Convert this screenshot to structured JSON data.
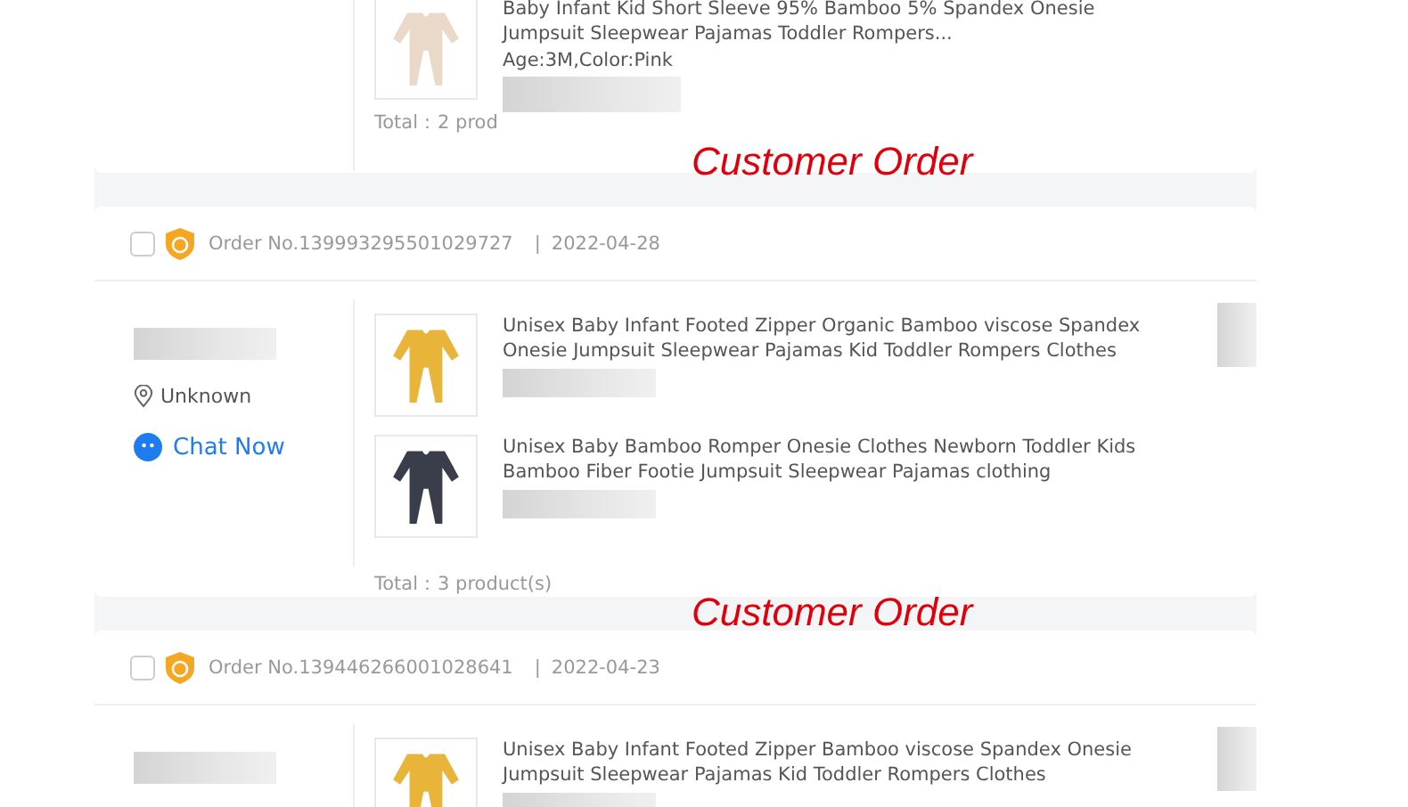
{
  "orders": [
    {
      "products": [
        {
          "title": "Baby Infant Kid Short Sleeve 95% Bamboo 5% Spandex Onesie Jumpsuit Sleepwear Pajamas Toddler Rompers...",
          "variant": "Age:3M,Color:Pink",
          "color": "#ead8c8"
        }
      ],
      "total": "Total：2 prod"
    },
    {
      "order_no": "Order No.139993295501029727",
      "separator": "|",
      "date": "2022-04-28",
      "checked": false,
      "location": "Unknown",
      "chat_label": "Chat Now",
      "products": [
        {
          "title": "Unisex Baby Infant Footed Zipper Organic Bamboo viscose Spandex Onesie Jumpsuit Sleepwear Pajamas Kid Toddler Rompers Clothes",
          "color": "#e8b53a"
        },
        {
          "title": "Unisex Baby Bamboo Romper Onesie Clothes Newborn Toddler Kids Bamboo Fiber Footie Jumpsuit Sleepwear Pajamas clothing",
          "color": "#3a3d4a"
        }
      ],
      "total": "Total：3 product(s)"
    },
    {
      "order_no": "Order No.139446266001028641",
      "separator": "|",
      "date": "2022-04-23",
      "checked": false,
      "products": [
        {
          "title": "Unisex Baby Infant Footed Zipper Bamboo viscose Spandex Onesie Jumpsuit Sleepwear Pajamas Kid Toddler Rompers Clothes",
          "color": "#e8b53a"
        }
      ]
    }
  ],
  "captions": [
    "Customer Order",
    "Customer Order"
  ]
}
